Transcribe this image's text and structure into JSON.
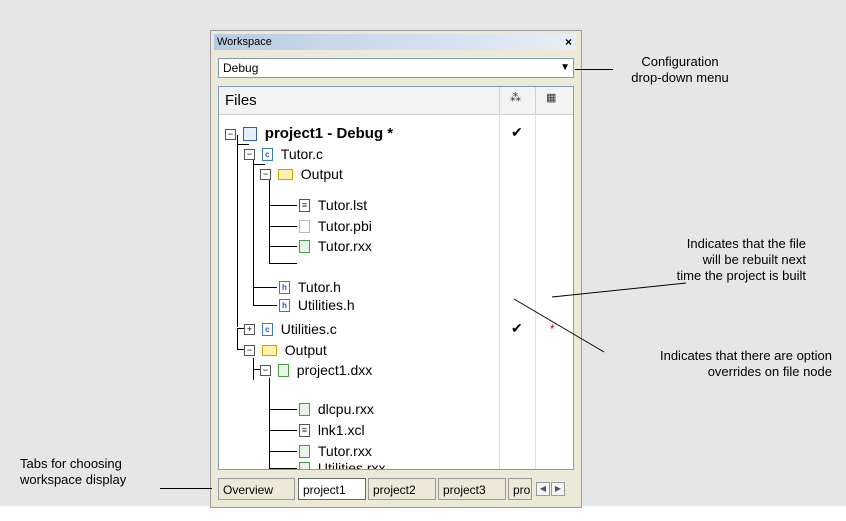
{
  "window": {
    "title": "Workspace",
    "close_glyph": "×"
  },
  "config_dropdown": {
    "value": "Debug",
    "arrow_glyph": "▼"
  },
  "tree": {
    "header": {
      "files_label": "Files",
      "col1_icon": "options-override-icon",
      "col2_icon": "rebuild-icon"
    },
    "rows": [
      {
        "label": "project1 - Debug *",
        "icon": "project-icon",
        "expander": "−",
        "check": "✔",
        "star": ""
      },
      {
        "label": "Tutor.c",
        "icon": "c-file-icon",
        "expander": "−",
        "check": "",
        "star": ""
      },
      {
        "label": "Output",
        "icon": "folder-icon",
        "expander": "−",
        "check": "",
        "star": ""
      },
      {
        "label": "Tutor.lst",
        "icon": "list-file-icon",
        "expander": "",
        "check": "",
        "star": ""
      },
      {
        "label": "Tutor.pbi",
        "icon": "blank-file-icon",
        "expander": "",
        "check": "",
        "star": ""
      },
      {
        "label": "Tutor.rxx",
        "icon": "output-file-icon",
        "expander": "",
        "check": "",
        "star": ""
      },
      {
        "label": "Tutor.h",
        "icon": "h-file-icon",
        "expander": "",
        "check": "",
        "star": ""
      },
      {
        "label": "Utilities.h",
        "icon": "h-file-icon",
        "expander": "",
        "check": "",
        "star": ""
      },
      {
        "label": "Utilities.c",
        "icon": "c-file-icon",
        "expander": "+",
        "check": "✔",
        "star": "*"
      },
      {
        "label": "Output",
        "icon": "folder-icon",
        "expander": "−",
        "check": "",
        "star": ""
      },
      {
        "label": "project1.dxx",
        "icon": "output-file-icon",
        "expander": "−",
        "check": "",
        "star": ""
      },
      {
        "label": "dlcpu.rxx",
        "icon": "output-file-icon",
        "expander": "",
        "check": "",
        "star": ""
      },
      {
        "label": "lnk1.xcl",
        "icon": "list-file-icon",
        "expander": "",
        "check": "",
        "star": ""
      },
      {
        "label": "Tutor.rxx",
        "icon": "output-file-icon",
        "expander": "",
        "check": "",
        "star": ""
      },
      {
        "label": "Utilities.rxx",
        "icon": "output-file-icon",
        "expander": "",
        "check": "",
        "star": ""
      }
    ]
  },
  "tabs": [
    {
      "label": "Overview",
      "active": false
    },
    {
      "label": "project1",
      "active": true
    },
    {
      "label": "project2",
      "active": false
    },
    {
      "label": "project3",
      "active": false
    },
    {
      "label": "pro",
      "active": false
    }
  ],
  "tab_scroll": {
    "left": "◀",
    "right": "▶"
  },
  "callouts": {
    "config_line1": "Configuration",
    "config_line2": "drop-down menu",
    "rebuild_line1": "Indicates that the file",
    "rebuild_line2": "will be rebuilt next",
    "rebuild_line3": "time the project is built",
    "override_line1": "Indicates that there are option",
    "override_line2": "overrides on file node",
    "tabs_line1": "Tabs for choosing",
    "tabs_line2": "workspace display"
  }
}
